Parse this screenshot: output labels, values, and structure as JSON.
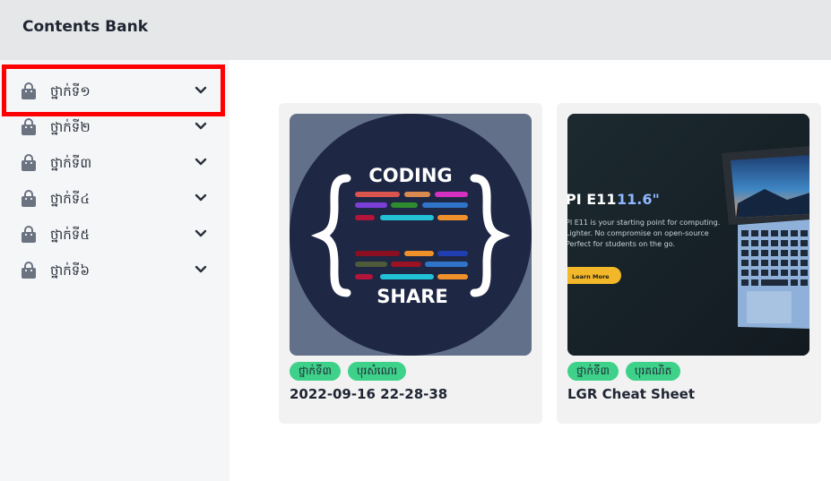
{
  "header": {
    "title": "Contents Bank"
  },
  "sidebar": {
    "items": [
      {
        "label": "ថ្នាក់ទី១",
        "icon": "shopping-bag-icon"
      },
      {
        "label": "ថ្នាក់ទី២",
        "icon": "shopping-bag-icon"
      },
      {
        "label": "ថ្នាក់ទី៣",
        "icon": "shopping-bag-icon"
      },
      {
        "label": "ថ្នាក់ទី៤",
        "icon": "shopping-bag-icon"
      },
      {
        "label": "ថ្នាក់ទី៥",
        "icon": "shopping-bag-icon"
      },
      {
        "label": "ថ្នាក់ទី៦",
        "icon": "shopping-bag-icon"
      }
    ],
    "highlighted_index": 0
  },
  "cards": [
    {
      "title": "2022-09-16 22-28-38",
      "tags": [
        "ថ្នាក់ទី៣",
        "បុរសំណេរ"
      ],
      "thumbnail": {
        "top_text": "CODING",
        "bottom_text": "SHARE"
      }
    },
    {
      "title": "LGR Cheat Sheet",
      "tags": [
        "ថ្នាក់ទី៣",
        "បុរគណិត"
      ],
      "thumbnail": {
        "heading": "PI  E11",
        "heading_accent": "11.6\"",
        "line1": "PI E11 is your starting point for computing.",
        "line2": "Lighter. No compromise on open-source",
        "line3": "Perfect for students on the go.",
        "button": "Learn More"
      }
    }
  ],
  "colors": {
    "header_bg": "#e6e7e8",
    "sidebar_bg": "#f5f6f8",
    "tag_bg": "#3ed18a",
    "highlight": "#ff0000"
  }
}
